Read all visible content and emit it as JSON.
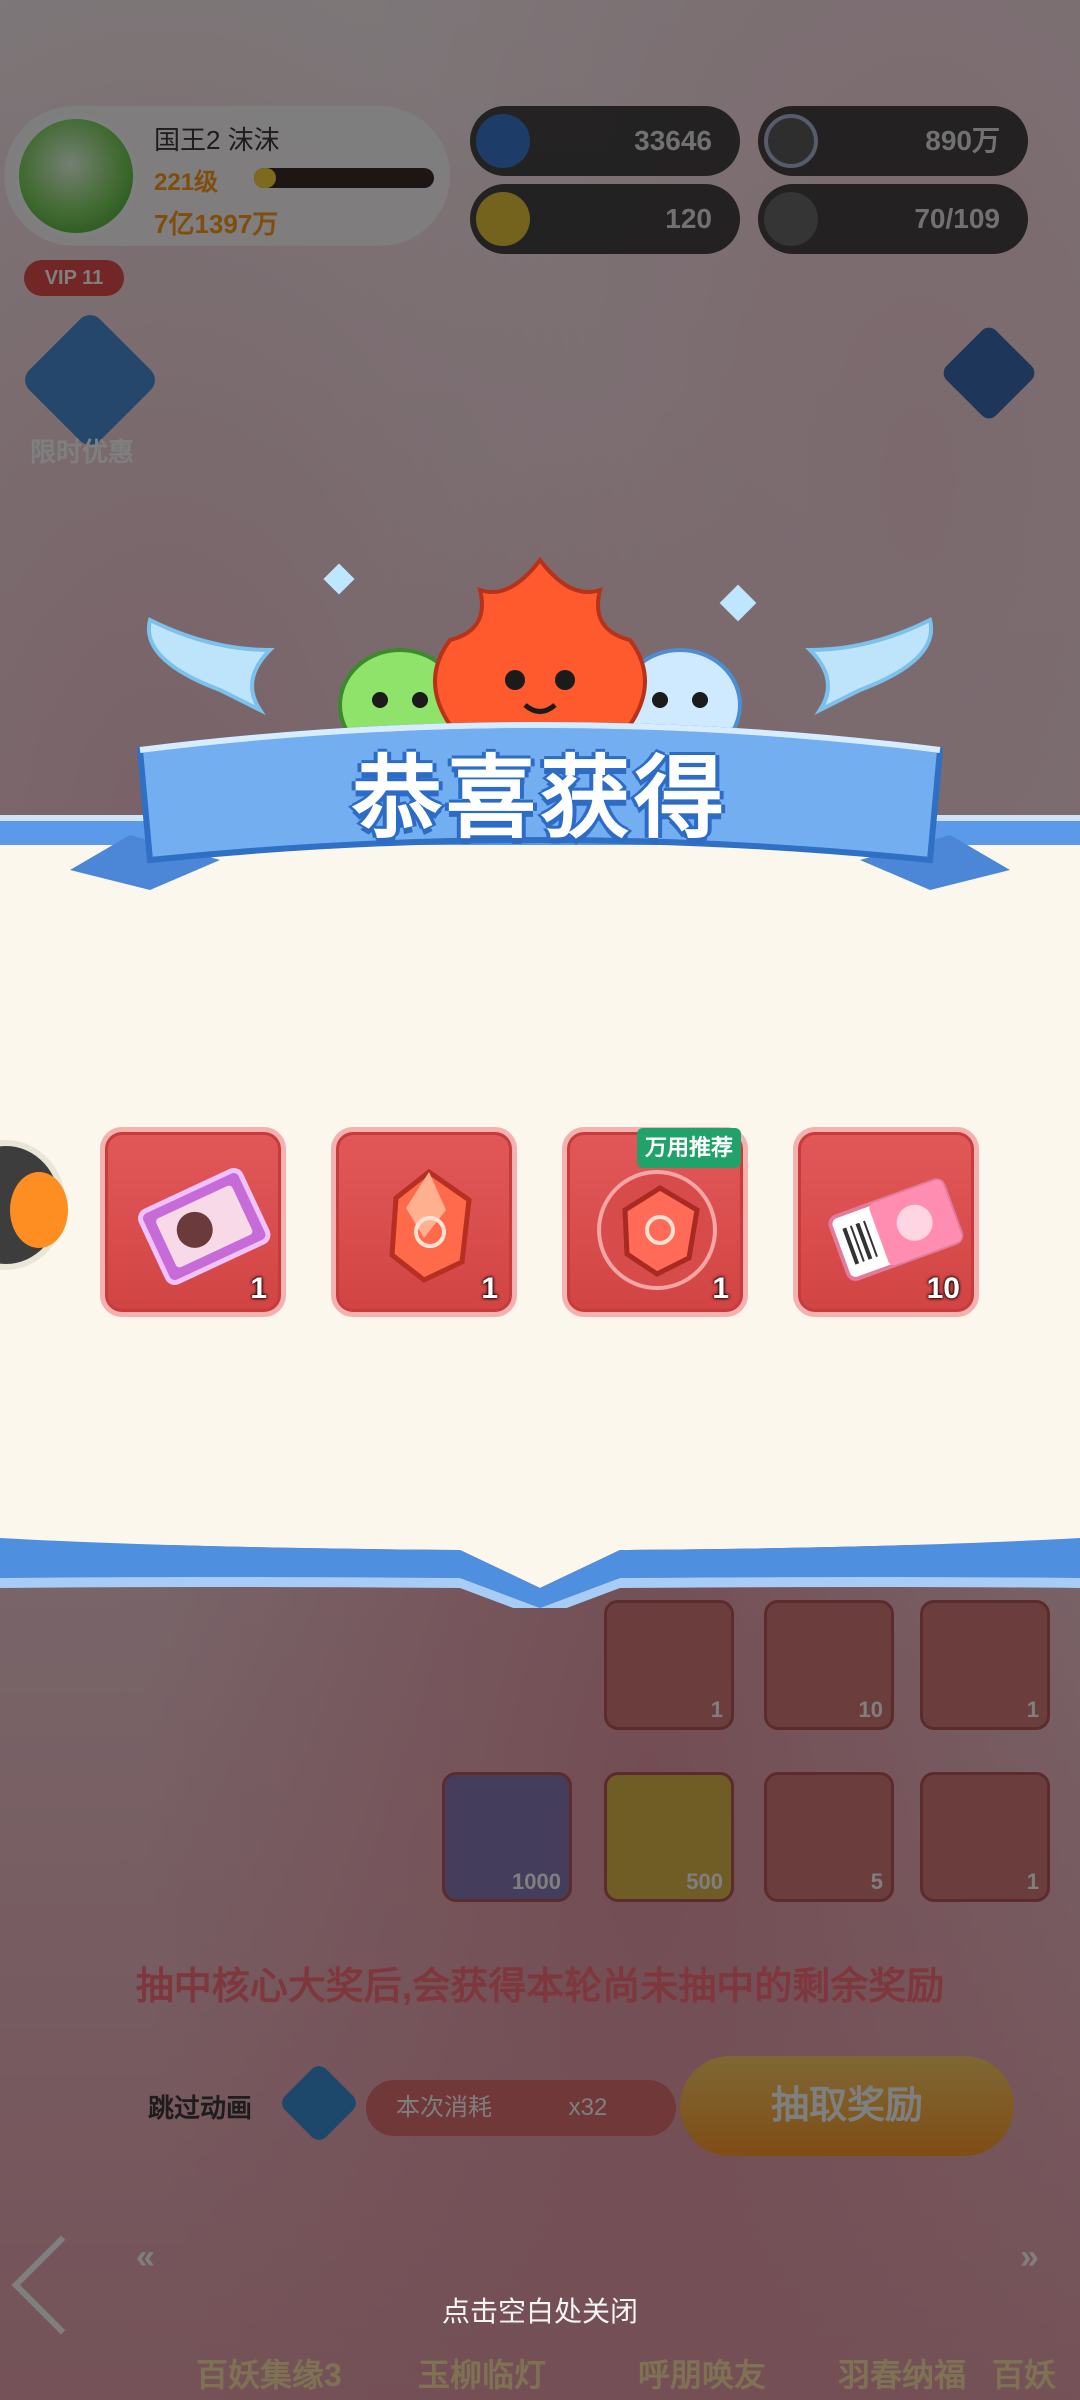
{
  "player": {
    "name": "国王2 沫沫",
    "level": "221级",
    "level_progress": 0.12,
    "power": "7亿1397万",
    "vip": "VIP 11"
  },
  "resources": {
    "stars": "33646",
    "timer_currency": "890万",
    "coins": "120",
    "team": "70/109"
  },
  "side": {
    "gift_label": "限时优惠"
  },
  "reward_popup": {
    "title": "恭喜获得",
    "items": [
      {
        "name": "character-card",
        "icon": "card-icon",
        "count": "1",
        "badge": ""
      },
      {
        "name": "red-crystal",
        "icon": "crystal-icon",
        "count": "1",
        "badge": ""
      },
      {
        "name": "red-token",
        "icon": "token-icon",
        "count": "1",
        "badge": "万用推荐"
      },
      {
        "name": "pink-ticket",
        "icon": "ticket-icon",
        "count": "10",
        "badge": ""
      }
    ],
    "close_hint": "点击空白处关闭"
  },
  "background_panel": {
    "row1_counts": [
      "1",
      "10",
      "1"
    ],
    "row2_counts": [
      "1000",
      "500",
      "5",
      "1"
    ],
    "hint": "抽中核心大奖后,会获得本轮尚未抽中的剩余奖励",
    "skip_label": "跳过动画",
    "cost_label": "本次消耗",
    "cost_value": "x32",
    "draw_button": "抽取奖励"
  },
  "bottom_tabs": [
    "百妖集缘3",
    "玉柳临灯",
    "呼朋唤友",
    "羽春纳福",
    "百妖"
  ],
  "colors": {
    "panel_bg": "#fbf7ec",
    "banner_blue": "#5a9ae8",
    "item_red": "#d84c4c",
    "badge_green": "#21a26a"
  }
}
